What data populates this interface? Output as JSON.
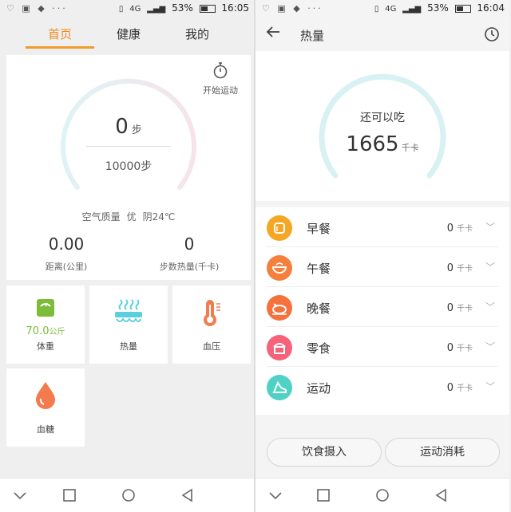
{
  "left": {
    "status": {
      "battery": "53%",
      "time": "16:05",
      "network": "4G"
    },
    "tabs": [
      {
        "label": "首页"
      },
      {
        "label": "健康"
      },
      {
        "label": "我的"
      }
    ],
    "steps": {
      "value": "0",
      "unit": "步",
      "goal": "10000步",
      "progress": 0
    },
    "start_exercise": "开始运动",
    "air": {
      "label": "空气质量",
      "quality": "优",
      "weather": "阴24℃"
    },
    "stats": [
      {
        "value": "0.00",
        "label": "距离(公里)"
      },
      {
        "value": "0",
        "label": "步数热量(千卡)"
      }
    ],
    "tiles": {
      "weight": {
        "value": "70.0",
        "unit": "公斤",
        "label": "体重",
        "icon": "scale-icon"
      },
      "calorie": {
        "label": "热量",
        "icon": "food-steam-icon"
      },
      "pressure": {
        "label": "血压",
        "icon": "thermometer-icon"
      },
      "sugar": {
        "label": "血糖",
        "icon": "blood-drop-icon"
      }
    }
  },
  "right": {
    "status": {
      "battery": "53%",
      "time": "16:04",
      "network": "4G"
    },
    "title": "热量",
    "remaining_label": "还可以吃",
    "remaining_value": "1665",
    "remaining_unit": "千卡",
    "meals": [
      {
        "name": "早餐",
        "value": "0",
        "unit": "千卡",
        "color": "#f5a623",
        "icon": "bread-icon"
      },
      {
        "name": "午餐",
        "value": "0",
        "unit": "千卡",
        "color": "#f57f3c",
        "icon": "bowl-icon"
      },
      {
        "name": "晚餐",
        "value": "0",
        "unit": "千卡",
        "color": "#f5723c",
        "icon": "chicken-icon"
      },
      {
        "name": "零食",
        "value": "0",
        "unit": "千卡",
        "color": "#f5627a",
        "icon": "cake-icon"
      },
      {
        "name": "运动",
        "value": "0",
        "unit": "千卡",
        "color": "#4fd1c5",
        "icon": "shoe-icon"
      }
    ],
    "buttons": {
      "intake": "饮食摄入",
      "exercise": "运动消耗"
    }
  },
  "colors": {
    "accent": "#f08a1b",
    "weight": "#7cbc3a",
    "cyan": "#5bd0dc"
  }
}
